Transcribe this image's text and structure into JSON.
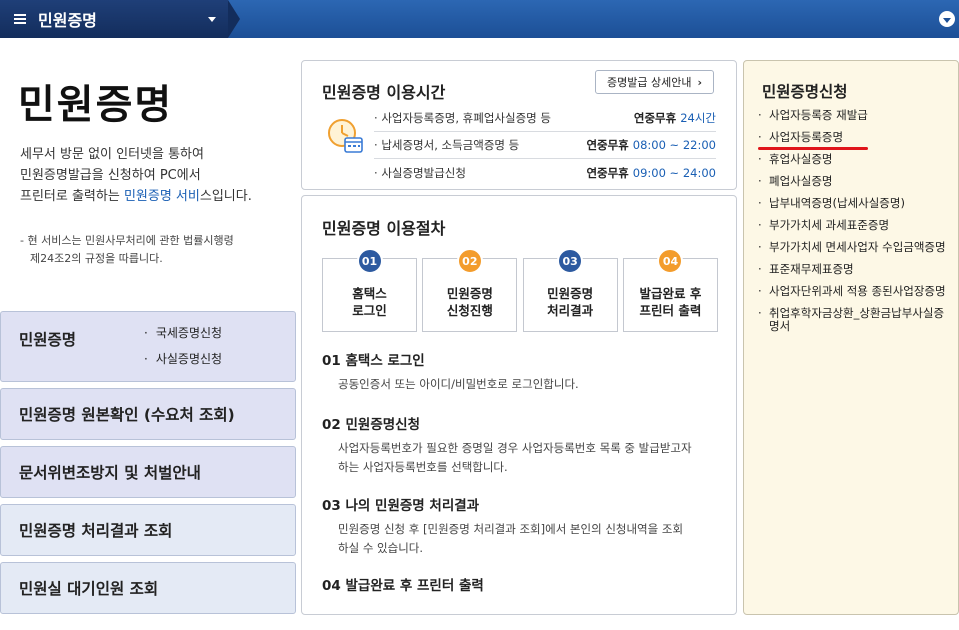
{
  "topbar": {
    "tab_label": "민원증명"
  },
  "left": {
    "title": "민원증명",
    "desc_line1": "세무서 방문 없이 인터넷을 통하여",
    "desc_line2": "민원증명발급을 신청하여 PC에서",
    "desc_line3_pre": "프린터로 출력하는 ",
    "desc_line3_hl": "민원증명 서비",
    "desc_line3_post": "스입니다.",
    "note_line1": "- 현 서비스는 민원사무처리에 관한 법률시행령",
    "note_line2": "제24조2의 규정을 따릅니다.",
    "menu": [
      {
        "label": "민원증명",
        "subs": [
          "국세증명신청",
          "사실증명신청"
        ]
      },
      {
        "label": "민원증명 원본확인 (수요처 조회)"
      },
      {
        "label": "문서위변조방지 및 처벌안내"
      },
      {
        "label": "민원증명 처리결과 조회"
      },
      {
        "label": "민원실 대기인원 조회"
      }
    ]
  },
  "hours_panel": {
    "title": "민원증명 이용시간",
    "detail_button": "증명발급 상세안내",
    "rows": [
      {
        "label": "사업자등록증명, 휴폐업사실증명 등",
        "day": "연중무휴",
        "time": "24시간"
      },
      {
        "label": "납세증명서, 소득금액증명 등",
        "day": "연중무휴",
        "time": "08:00 ~ 22:00"
      },
      {
        "label": "사실증명발급신청",
        "day": "연중무휴",
        "time": "09:00 ~ 24:00"
      }
    ]
  },
  "procedure_panel": {
    "title": "민원증명 이용절차",
    "steps": [
      {
        "num": "01",
        "line1": "홈택스",
        "line2": "로그인",
        "color": "#2d5aa0"
      },
      {
        "num": "02",
        "line1": "민원증명",
        "line2": "신청진행",
        "color": "#f39c2c"
      },
      {
        "num": "03",
        "line1": "민원증명",
        "line2": "처리결과",
        "color": "#2d5aa0"
      },
      {
        "num": "04",
        "line1": "발급완료 후",
        "line2": "프린터 출력",
        "color": "#f39c2c"
      }
    ],
    "items": [
      {
        "heading": "01 홈택스 로그인",
        "text1": "공동인증서 또는 아이디/비밀번호로 로그인합니다.",
        "text2": ""
      },
      {
        "heading": "02 민원증명신청",
        "text1": "사업자등록번호가 필요한 증명일 경우 사업자등록번호 목록 중 발급받고자",
        "text2": "하는 사업자등록번호를 선택합니다."
      },
      {
        "heading": "03 나의 민원증명 처리결과",
        "text1": "민원증명 신청 후 [민원증명 처리결과 조회]에서 본인의 신청내역을 조회",
        "text2": "하실 수 있습니다."
      },
      {
        "heading": "04 발급완료 후 프린터 출력",
        "text1": "",
        "text2": ""
      }
    ]
  },
  "right_panel": {
    "title": "민원증명신청",
    "items": [
      "사업자등록증 재발급",
      "사업자등록증명",
      "휴업사실증명",
      "폐업사실증명",
      "납부내역증명(납세사실증명)",
      "부가가치세 과세표준증명",
      "부가가치세 면세사업자 수입금액증명",
      "표준재무제표증명",
      "사업자단위과세 적용 종된사업장증명",
      "취업후학자금상환_상환금납부사실증명서"
    ]
  }
}
